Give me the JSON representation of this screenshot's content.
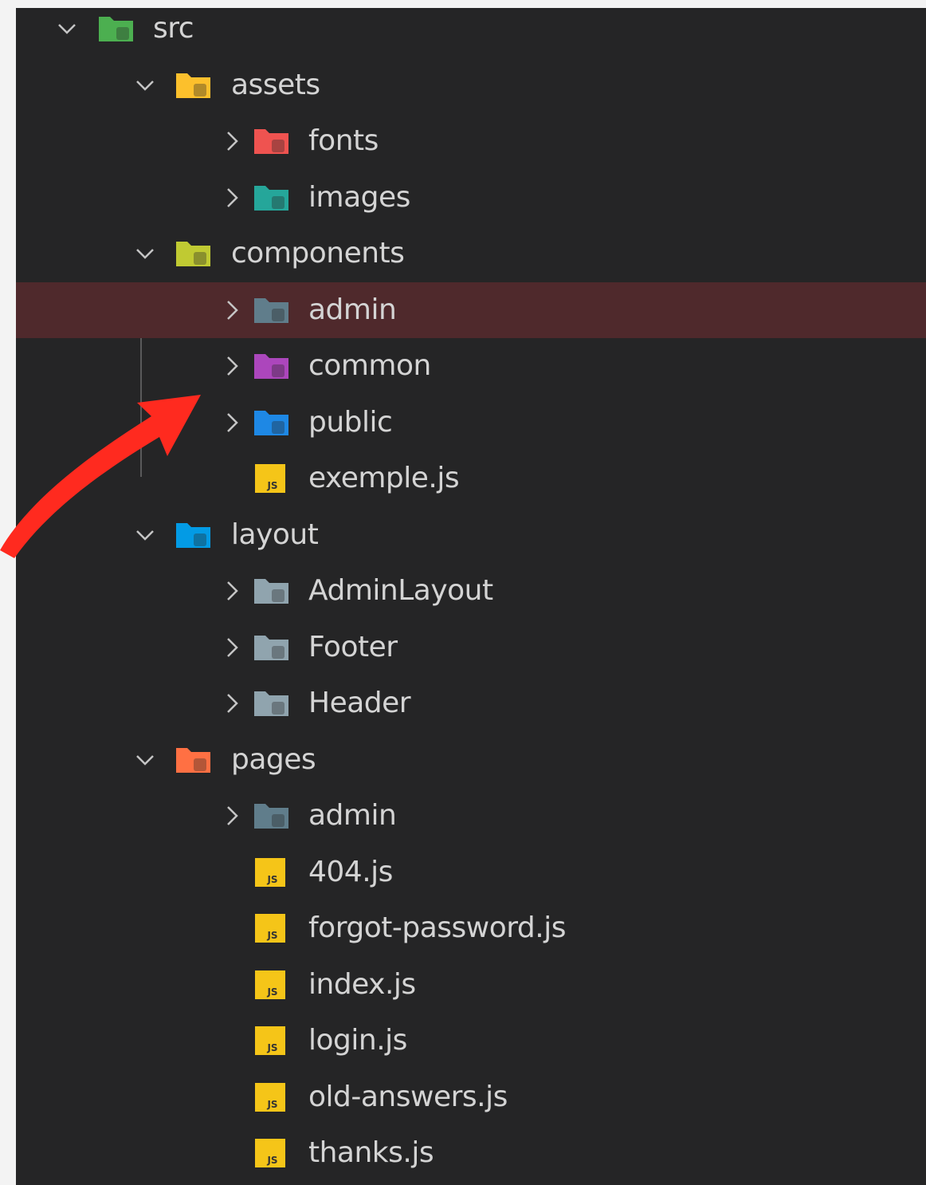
{
  "explorer": {
    "selected_color": "#4f292c",
    "arrow_color": "#ff2a1f",
    "items": [
      {
        "label": "src",
        "kind": "folder",
        "icon": "src-folder-icon",
        "color": "#4caf50",
        "depth": 0,
        "expanded": true
      },
      {
        "label": "assets",
        "kind": "folder",
        "icon": "assets-folder-icon",
        "color": "#fbc02d",
        "depth": 1,
        "expanded": true
      },
      {
        "label": "fonts",
        "kind": "folder",
        "icon": "fonts-folder-icon",
        "color": "#ef5350",
        "depth": 2,
        "expanded": false
      },
      {
        "label": "images",
        "kind": "folder",
        "icon": "images-folder-icon",
        "color": "#26a69a",
        "depth": 2,
        "expanded": false
      },
      {
        "label": "components",
        "kind": "folder",
        "icon": "components-folder-icon",
        "color": "#c0ca33",
        "depth": 1,
        "expanded": true
      },
      {
        "label": "admin",
        "kind": "folder",
        "icon": "admin-folder-icon",
        "color": "#607d8b",
        "depth": 2,
        "expanded": false,
        "selected": true
      },
      {
        "label": "common",
        "kind": "folder",
        "icon": "common-folder-icon",
        "color": "#ab47bc",
        "depth": 2,
        "expanded": false
      },
      {
        "label": "public",
        "kind": "folder",
        "icon": "public-folder-icon",
        "color": "#1e88e5",
        "depth": 2,
        "expanded": false
      },
      {
        "label": "exemple.js",
        "kind": "file",
        "icon": "javascript-file-icon",
        "color": "#f5c518",
        "depth": 2
      },
      {
        "label": "layout",
        "kind": "folder",
        "icon": "layout-folder-icon",
        "color": "#039be5",
        "depth": 1,
        "expanded": true
      },
      {
        "label": "AdminLayout",
        "kind": "folder",
        "icon": "folder-icon",
        "color": "#90a4ae",
        "depth": 2,
        "expanded": false
      },
      {
        "label": "Footer",
        "kind": "folder",
        "icon": "folder-icon",
        "color": "#90a4ae",
        "depth": 2,
        "expanded": false
      },
      {
        "label": "Header",
        "kind": "folder",
        "icon": "folder-icon",
        "color": "#90a4ae",
        "depth": 2,
        "expanded": false
      },
      {
        "label": "pages",
        "kind": "folder",
        "icon": "pages-folder-icon",
        "color": "#ff7043",
        "depth": 1,
        "expanded": true
      },
      {
        "label": "admin",
        "kind": "folder",
        "icon": "admin-folder-icon",
        "color": "#607d8b",
        "depth": 2,
        "expanded": false
      },
      {
        "label": "404.js",
        "kind": "file",
        "icon": "javascript-file-icon",
        "color": "#f5c518",
        "depth": 2
      },
      {
        "label": "forgot-password.js",
        "kind": "file",
        "icon": "javascript-file-icon",
        "color": "#f5c518",
        "depth": 2
      },
      {
        "label": "index.js",
        "kind": "file",
        "icon": "javascript-file-icon",
        "color": "#f5c518",
        "depth": 2
      },
      {
        "label": "login.js",
        "kind": "file",
        "icon": "javascript-file-icon",
        "color": "#f5c518",
        "depth": 2
      },
      {
        "label": "old-answers.js",
        "kind": "file",
        "icon": "javascript-file-icon",
        "color": "#f5c518",
        "depth": 2
      },
      {
        "label": "thanks.js",
        "kind": "file",
        "icon": "javascript-file-icon",
        "color": "#f5c518",
        "depth": 2
      }
    ]
  }
}
